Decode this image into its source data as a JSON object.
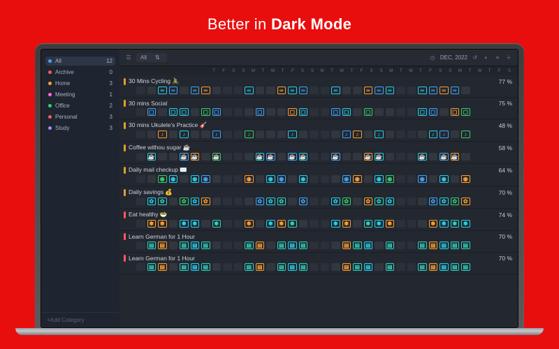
{
  "page": {
    "tagline_a": "Better in ",
    "tagline_b": "Dark Mode"
  },
  "sidebar": {
    "items": [
      {
        "label": "All",
        "count": 12,
        "color": "#4aa3ff",
        "selected": true
      },
      {
        "label": "Archive",
        "count": 0,
        "color": "#ff5a5a",
        "selected": false
      },
      {
        "label": "Home",
        "count": 3,
        "color": "#ff9f2e",
        "selected": false
      },
      {
        "label": "Meeting",
        "count": 1,
        "color": "#ff6bd6",
        "selected": false
      },
      {
        "label": "Office",
        "count": 2,
        "color": "#34d170",
        "selected": false
      },
      {
        "label": "Personal",
        "count": 3,
        "color": "#ff5a5a",
        "selected": false
      },
      {
        "label": "Study",
        "count": 3,
        "color": "#b583ff",
        "selected": false
      }
    ],
    "add_label": "+Add Category"
  },
  "toolbar": {
    "filter_label": "All",
    "month_label": "DEC, 2022"
  },
  "day_header": [
    "T",
    "F",
    "S",
    "S",
    "M",
    "T",
    "W",
    "T",
    "F",
    "S",
    "S",
    "M",
    "T",
    "W",
    "T",
    "F",
    "S",
    "S",
    "M",
    "T",
    "W",
    "T",
    "F",
    "S",
    "S",
    "M",
    "T",
    "W",
    "T",
    "F",
    "S"
  ],
  "glyph_legend": {
    "inf": "∞",
    "book": "▭",
    "star": "✦",
    "tv": "▢",
    "note": "♪",
    "cup": "☕",
    "mail": "✉",
    "eye": "◉",
    "pig": "✿",
    "leaf": "❀",
    "salad": "❃",
    "de": "▤"
  },
  "habits": [
    {
      "name": "30 Mins Cycling 🚴",
      "bar": "#e0a030",
      "pct": "77 %",
      "cells": [
        "v",
        "b",
        "inf:cyan",
        "inf:blue",
        "b",
        "inf:blue",
        "inf:orange",
        "b",
        "v",
        "v",
        "inf:cyan",
        "b",
        "b",
        "inf:orange",
        "inf:cyan",
        "inf:blue",
        "v",
        "v",
        "inf:cyan",
        "b",
        "b",
        "inf:orange",
        "inf:blue",
        "inf:cyan",
        "v",
        "v",
        "inf:cyan",
        "inf:blue",
        "inf:orange",
        "inf:blue",
        "b"
      ]
    },
    {
      "name": "30 mins Social",
      "bar": "#e0a030",
      "pct": "75 %",
      "cells": [
        "v",
        "tv:blue",
        "b",
        "tv:cyan",
        "tv:cyan",
        "b",
        "tv:green",
        "tv:blue",
        "v",
        "v",
        "b",
        "tv:blue",
        "b",
        "b",
        "tv:orange",
        "tv:cyan",
        "v",
        "v",
        "tv:blue",
        "tv:cyan",
        "b",
        "tv:green",
        "b",
        "b",
        "v",
        "v",
        "tv:cyan",
        "tv:blue",
        "b",
        "tv:orange",
        "tv:green"
      ]
    },
    {
      "name": "30 mins Ukulele's Practice 🎸",
      "bar": "#e0a030",
      "pct": "48 %",
      "cells": [
        "v",
        "b",
        "note:orange",
        "b",
        "note:cyan",
        "b",
        "b",
        "note:blue",
        "v",
        "v",
        "note:green",
        "b",
        "b",
        "b",
        "note:cyan",
        "b",
        "v",
        "v",
        "b",
        "note:blue",
        "note:orange",
        "b",
        "note:cyan",
        "b",
        "v",
        "v",
        "b",
        "note:cyan",
        "note:blue",
        "b",
        "note:green"
      ]
    },
    {
      "name": "Coffee withou sugar ☕",
      "bar": "#e0a030",
      "pct": "58 %",
      "cells": [
        "v",
        "cup:cyan",
        "b",
        "b",
        "cup:blue",
        "cup:orange",
        "b",
        "cup:green",
        "v",
        "v",
        "b",
        "cup:cyan",
        "cup:blue",
        "b",
        "cup:blue",
        "cup:cyan",
        "v",
        "v",
        "cup:blue",
        "b",
        "b",
        "cup:orange",
        "cup:cyan",
        "b",
        "v",
        "v",
        "cup:cyan",
        "b",
        "cup:blue",
        "cup:orange",
        "b"
      ]
    },
    {
      "name": "Daily mail checkup ✉️",
      "bar": "#e0a030",
      "pct": "64 %",
      "cells": [
        "v",
        "b",
        "eye:green",
        "eye:cyan",
        "b",
        "eye:cyan",
        "eye:blue",
        "b",
        "v",
        "v",
        "eye:orange",
        "b",
        "eye:cyan",
        "eye:blue",
        "b",
        "eye:cyan",
        "v",
        "v",
        "b",
        "eye:blue",
        "eye:orange",
        "b",
        "eye:cyan",
        "eye:green",
        "v",
        "v",
        "eye:blue",
        "b",
        "eye:cyan",
        "b",
        "eye:orange"
      ]
    },
    {
      "name": "Daily savings 💰",
      "bar": "#e0a030",
      "pct": "70 %",
      "cells": [
        "v",
        "pig:cyan",
        "pig:teal",
        "b",
        "pig:green",
        "pig:cyan",
        "pig:orange",
        "b",
        "v",
        "v",
        "b",
        "pig:blue",
        "pig:cyan",
        "pig:teal",
        "b",
        "pig:blue",
        "v",
        "v",
        "pig:cyan",
        "pig:green",
        "b",
        "pig:orange",
        "pig:teal",
        "pig:cyan",
        "v",
        "v",
        "b",
        "pig:blue",
        "pig:cyan",
        "pig:green",
        "pig:orange"
      ]
    },
    {
      "name": "Eat healthy 🥗",
      "bar": "#ff5a5a",
      "pct": "74 %",
      "cells": [
        "v",
        "salad:orange",
        "salad:orange",
        "b",
        "salad:cyan",
        "salad:cyan",
        "b",
        "salad:teal",
        "v",
        "v",
        "salad:orange",
        "b",
        "salad:cyan",
        "salad:orange",
        "salad:teal",
        "b",
        "v",
        "v",
        "salad:cyan",
        "salad:orange",
        "b",
        "salad:teal",
        "salad:cyan",
        "salad:orange",
        "v",
        "v",
        "b",
        "salad:orange",
        "salad:cyan",
        "salad:teal",
        "salad:cyan"
      ]
    },
    {
      "name": "Learn German for 1 Hour",
      "bar": "#ff5a5a",
      "pct": "70 %",
      "cells": [
        "v",
        "de:teal",
        "de:orange",
        "b",
        "de:teal",
        "de:cyan",
        "de:teal",
        "b",
        "v",
        "v",
        "de:teal",
        "de:orange",
        "b",
        "de:teal",
        "de:cyan",
        "de:teal",
        "v",
        "v",
        "b",
        "de:orange",
        "de:teal",
        "de:cyan",
        "b",
        "de:teal",
        "v",
        "v",
        "de:teal",
        "de:orange",
        "de:cyan",
        "de:teal",
        "de:teal"
      ]
    },
    {
      "name": "Learn German for 1 Hour",
      "bar": "#ff5a5a",
      "pct": "70 %",
      "cells": [
        "v",
        "de:teal",
        "de:orange",
        "b",
        "de:teal",
        "de:cyan",
        "de:teal",
        "b",
        "v",
        "v",
        "de:teal",
        "de:orange",
        "b",
        "de:teal",
        "de:cyan",
        "de:teal",
        "v",
        "v",
        "b",
        "de:orange",
        "de:teal",
        "de:cyan",
        "b",
        "de:teal",
        "v",
        "v",
        "de:teal",
        "de:orange",
        "de:cyan",
        "de:teal",
        "de:teal"
      ]
    }
  ]
}
